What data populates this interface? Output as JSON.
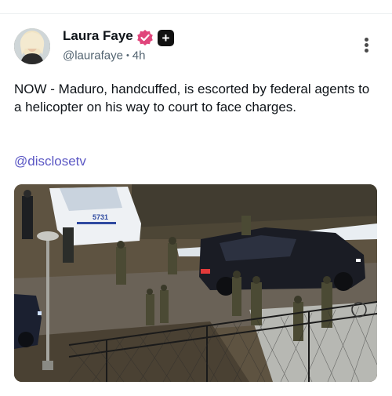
{
  "author": {
    "display_name": "Laura Faye",
    "handle": "@laurafaye",
    "separator": "•",
    "time_ago": "4h",
    "verified_icon": "verified-badge-icon",
    "extra_badge_icon": "plus-badge-icon",
    "plus_symbol": "+"
  },
  "post": {
    "text": "NOW - Maduro, handcuffed, is escorted by federal agents to a helicopter on his way to court to face charges.",
    "mention": "@disclosetv"
  },
  "media": {
    "type": "aerial-photo",
    "police_car_number": "5731"
  },
  "menu": {
    "more_icon": "more-vertical-icon"
  },
  "colors": {
    "verified": "#e0457b",
    "link": "#5b57c4",
    "handle": "#536471",
    "text": "#0f1419"
  }
}
